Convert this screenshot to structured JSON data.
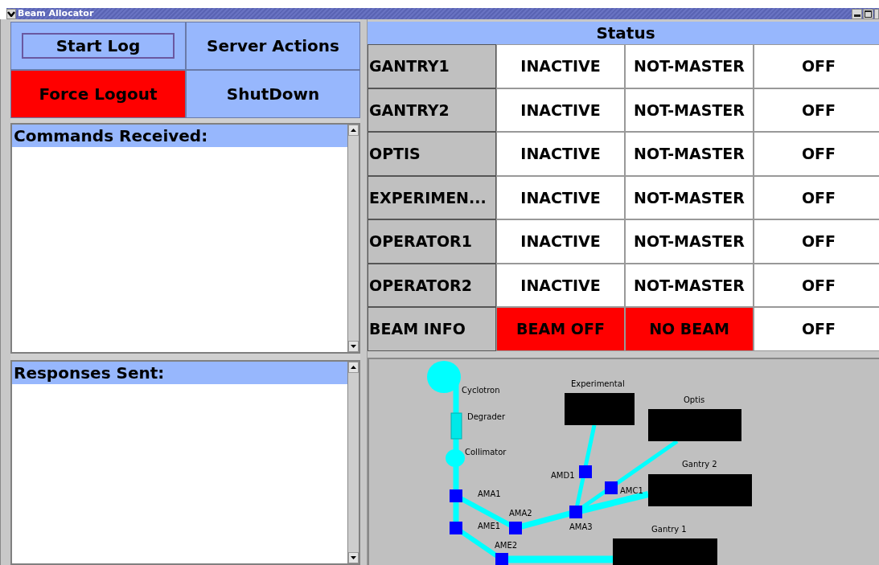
{
  "window": {
    "title": "Beam Allocator"
  },
  "buttons": [
    {
      "label": "Start Log",
      "alarm": false,
      "focused": true
    },
    {
      "label": "Server Actions",
      "alarm": false,
      "focused": false
    },
    {
      "label": "Force Logout",
      "alarm": true,
      "focused": false
    },
    {
      "label": "ShutDown",
      "alarm": false,
      "focused": false
    }
  ],
  "commands_panel": {
    "title": "Commands Received:"
  },
  "responses_panel": {
    "title": "Responses Sent:"
  },
  "status": {
    "title": "Status",
    "rows": [
      {
        "name": "GANTRY1",
        "cells": [
          {
            "text": "INACTIVE",
            "alarm": false
          },
          {
            "text": "NOT-MASTER",
            "alarm": false
          },
          {
            "text": "OFF",
            "alarm": false
          }
        ]
      },
      {
        "name": "GANTRY2",
        "cells": [
          {
            "text": "INACTIVE",
            "alarm": false
          },
          {
            "text": "NOT-MASTER",
            "alarm": false
          },
          {
            "text": "OFF",
            "alarm": false
          }
        ]
      },
      {
        "name": "OPTIS",
        "cells": [
          {
            "text": "INACTIVE",
            "alarm": false
          },
          {
            "text": "NOT-MASTER",
            "alarm": false
          },
          {
            "text": "OFF",
            "alarm": false
          }
        ]
      },
      {
        "name": "EXPERIMEN...",
        "cells": [
          {
            "text": "INACTIVE",
            "alarm": false
          },
          {
            "text": "NOT-MASTER",
            "alarm": false
          },
          {
            "text": "OFF",
            "alarm": false
          }
        ]
      },
      {
        "name": "OPERATOR1",
        "cells": [
          {
            "text": "INACTIVE",
            "alarm": false
          },
          {
            "text": "NOT-MASTER",
            "alarm": false
          },
          {
            "text": "OFF",
            "alarm": false
          }
        ]
      },
      {
        "name": "OPERATOR2",
        "cells": [
          {
            "text": "INACTIVE",
            "alarm": false
          },
          {
            "text": "NOT-MASTER",
            "alarm": false
          },
          {
            "text": "OFF",
            "alarm": false
          }
        ]
      },
      {
        "name": "BEAM INFO",
        "cells": [
          {
            "text": "BEAM OFF",
            "alarm": true
          },
          {
            "text": "NO BEAM",
            "alarm": true
          },
          {
            "text": "OFF",
            "alarm": false
          }
        ]
      }
    ]
  },
  "beamline": {
    "nodes": [
      {
        "label": "Cyclotron",
        "kind": "source"
      },
      {
        "label": "Degrader",
        "kind": "degrader"
      },
      {
        "label": "Collimator",
        "kind": "collimator"
      },
      {
        "label": "AMA1",
        "kind": "magnet"
      },
      {
        "label": "AME1",
        "kind": "magnet"
      },
      {
        "label": "AMA2",
        "kind": "magnet"
      },
      {
        "label": "AMA3",
        "kind": "magnet"
      },
      {
        "label": "AMD1",
        "kind": "magnet"
      },
      {
        "label": "AMC1",
        "kind": "magnet"
      },
      {
        "label": "AME2",
        "kind": "magnet"
      },
      {
        "label": "Experimental",
        "kind": "room"
      },
      {
        "label": "Optis",
        "kind": "room"
      },
      {
        "label": "Gantry 2",
        "kind": "room"
      },
      {
        "label": "Gantry 1",
        "kind": "room"
      }
    ]
  }
}
